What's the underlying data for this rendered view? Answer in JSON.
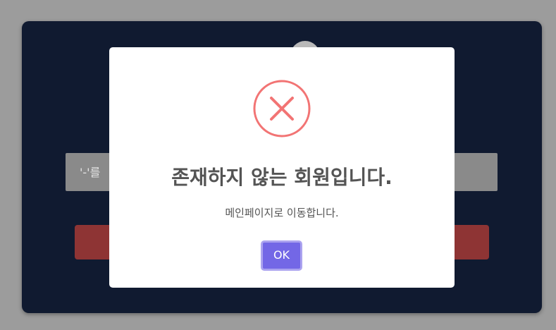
{
  "background": {
    "input_text": "'-'를",
    "colors": {
      "page": "#9c9c9c",
      "card": "#101a30",
      "input": "#8a8a8a",
      "button": "#8e3434"
    }
  },
  "dialog": {
    "icon": "error-x-icon",
    "title": "존재하지 않는 회원입니다.",
    "text": "메인페이지로 이동합니다.",
    "confirm_label": "OK",
    "colors": {
      "error_icon": "#f27474",
      "confirm_button": "#7367e6",
      "text": "#545454"
    }
  }
}
